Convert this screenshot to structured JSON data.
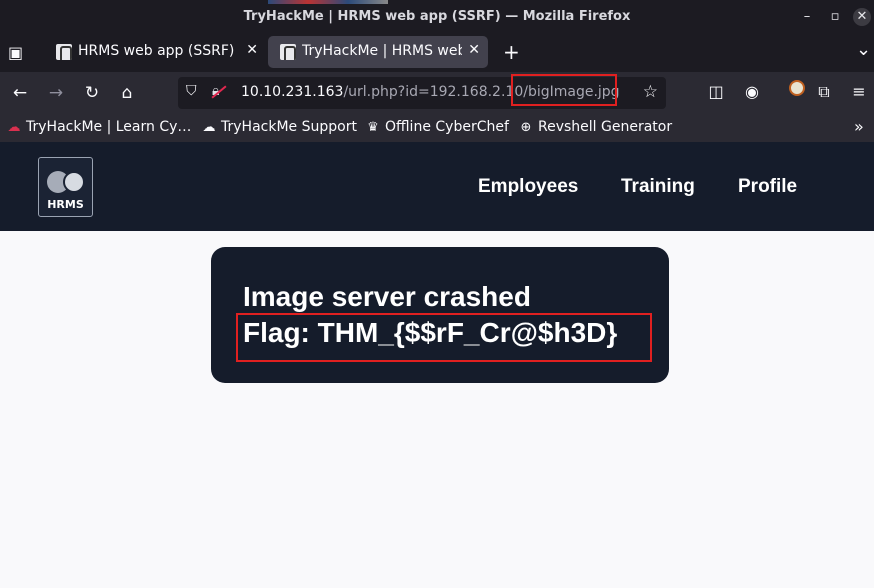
{
  "window": {
    "title": "TryHackMe | HRMS web app (SSRF) — Mozilla Firefox",
    "controls": {
      "minimize": "–",
      "maximize": "▫",
      "close": "✕"
    }
  },
  "tabs": [
    {
      "label": "HRMS web app (SSRF)",
      "active": false,
      "close": "✕"
    },
    {
      "label": "TryHackMe | HRMS web a",
      "active": true,
      "close": "✕"
    }
  ],
  "tabstrip": {
    "new_tab": "+",
    "list_all": "⌄"
  },
  "navbar": {
    "url_host": "10.10.231.163",
    "url_path": "/url.php?id=192.168.2.10/bigImage.jpg",
    "highlighted_segment": "bigImage.jpg"
  },
  "bookmarks": [
    {
      "label": "TryHackMe | Learn Cy…",
      "icon": "tryhackme-icon"
    },
    {
      "label": "TryHackMe Support",
      "icon": "cloud-icon"
    },
    {
      "label": "Offline CyberChef",
      "icon": "chef-icon"
    },
    {
      "label": "Revshell Generator",
      "icon": "globe-icon"
    }
  ],
  "site": {
    "logo_text": "HRMS",
    "nav": [
      "Employees",
      "Training",
      "Profile"
    ]
  },
  "message": {
    "line1": "Image server crashed",
    "line2": "Flag: THM_{$$rF_Cr@$h3D}"
  },
  "colors": {
    "header_bg": "#151c2b",
    "highlight_border": "#e02020",
    "page_bg": "#f9f9fb"
  }
}
